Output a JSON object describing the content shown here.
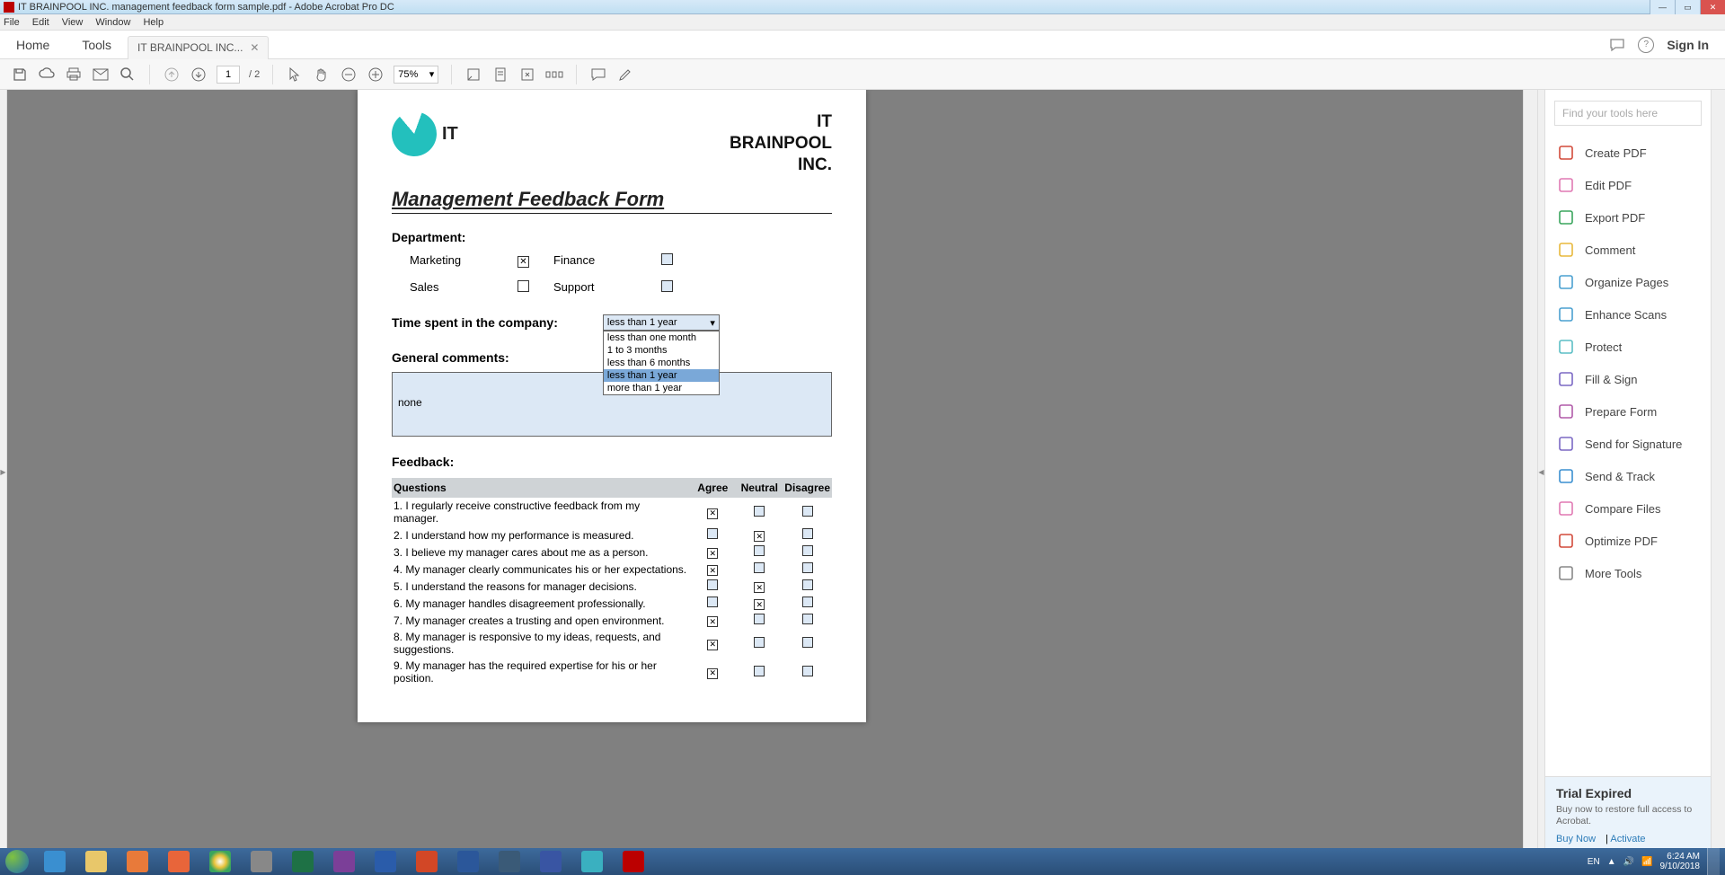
{
  "window": {
    "title": "IT BRAINPOOL INC. management feedback form sample.pdf - Adobe Acrobat Pro DC"
  },
  "menubar": [
    "File",
    "Edit",
    "View",
    "Window",
    "Help"
  ],
  "tabs": {
    "home": "Home",
    "tools": "Tools",
    "doc": "IT BRAINPOOL INC...",
    "signin": "Sign In"
  },
  "toolbar": {
    "page_current": "1",
    "page_total": "/ 2",
    "zoom": "75%"
  },
  "sidepanel": {
    "search_placeholder": "Find your tools here",
    "items": [
      {
        "label": "Create PDF",
        "color": "#d24a3a"
      },
      {
        "label": "Edit PDF",
        "color": "#e079b3"
      },
      {
        "label": "Export PDF",
        "color": "#3aa55d"
      },
      {
        "label": "Comment",
        "color": "#e8b83b"
      },
      {
        "label": "Organize Pages",
        "color": "#4aa0d0"
      },
      {
        "label": "Enhance Scans",
        "color": "#4aa0d0"
      },
      {
        "label": "Protect",
        "color": "#5bbec5"
      },
      {
        "label": "Fill & Sign",
        "color": "#7b68c4"
      },
      {
        "label": "Prepare Form",
        "color": "#b05aa8"
      },
      {
        "label": "Send for Signature",
        "color": "#7b68c4"
      },
      {
        "label": "Send & Track",
        "color": "#3a8fd0"
      },
      {
        "label": "Compare Files",
        "color": "#e079b3"
      },
      {
        "label": "Optimize PDF",
        "color": "#d24a3a"
      },
      {
        "label": "More Tools",
        "color": "#888"
      }
    ],
    "trial_title": "Trial Expired",
    "trial_text": "Buy now to restore full access to Acrobat.",
    "trial_buy": "Buy Now",
    "trial_activate": "Activate"
  },
  "doc": {
    "logo_text": "IT",
    "company": "IT BRAINPOOL INC.",
    "title": "Management Feedback Form",
    "dept_label": "Department:",
    "depts": [
      {
        "name": "Marketing",
        "checked": true,
        "blue": false
      },
      {
        "name": "Finance",
        "checked": false,
        "blue": true
      },
      {
        "name": "Sales",
        "checked": false,
        "blue": false
      },
      {
        "name": "Support",
        "checked": false,
        "blue": true
      }
    ],
    "time_label": "Time spent in the company:",
    "time_value": "less than 1 year",
    "time_options": [
      "less than one month",
      "1 to 3 months",
      "less than 6 months",
      "less than 1 year",
      "more than 1 year"
    ],
    "time_selected_index": 3,
    "comments_label": "General comments:",
    "comments_value": "none",
    "feedback_label": "Feedback:",
    "cols": {
      "q": "Questions",
      "a": "Agree",
      "n": "Neutral",
      "d": "Disagree"
    },
    "rows": [
      {
        "q": "1. I regularly receive constructive feedback from my manager.",
        "a": true,
        "n": false,
        "d": false
      },
      {
        "q": "2. I understand how my performance is measured.",
        "a": false,
        "n": true,
        "d": false
      },
      {
        "q": "3. I believe my manager cares about me as a person.",
        "a": true,
        "n": false,
        "d": false
      },
      {
        "q": "4. My manager clearly communicates his or her expectations.",
        "a": true,
        "n": false,
        "d": false
      },
      {
        "q": "5. I understand the reasons for manager decisions.",
        "a": false,
        "n": true,
        "d": false
      },
      {
        "q": "6. My manager handles disagreement professionally.",
        "a": false,
        "n": true,
        "d": false
      },
      {
        "q": "7. My manager creates a trusting and open environment.",
        "a": true,
        "n": false,
        "d": false
      },
      {
        "q": "8. My manager is responsive to my ideas, requests, and suggestions.",
        "a": true,
        "n": false,
        "d": false
      },
      {
        "q": "9. My manager has the required expertise for his or her position.",
        "a": true,
        "n": false,
        "d": false
      }
    ]
  },
  "tray": {
    "lang": "EN",
    "time": "6:24 AM",
    "date": "9/10/2018"
  }
}
